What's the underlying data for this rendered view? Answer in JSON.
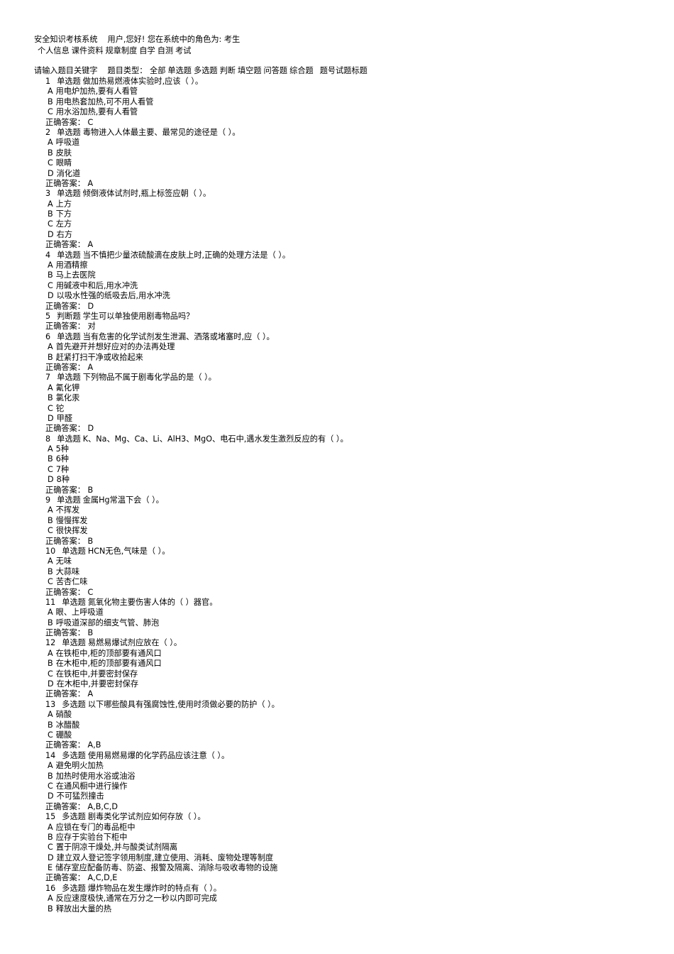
{
  "header": {
    "system_title": "安全知识考核系统",
    "greeting": "用户,您好! 您在系统中的角色为:",
    "role": "考生",
    "nav": [
      "个人信息",
      "课件资料",
      "规章制度",
      "自学",
      "自测",
      "考试"
    ]
  },
  "filter": {
    "keyword_prompt": "请输入题目关键字",
    "type_label": "题目类型：",
    "types": [
      "全部",
      "单选题",
      "多选题",
      "判断",
      "填空题",
      "问答题",
      "综合题"
    ],
    "number_label": "题号",
    "title_label": "试题标题"
  },
  "answer_label": "正确答案：",
  "questions": [
    {
      "num": "1",
      "type": "单选题",
      "text": "做加热易燃液体实验时,应该（ ）。",
      "options": [
        [
          "A",
          "用电炉加热,要有人看管"
        ],
        [
          "B",
          "用电热套加热,可不用人看管"
        ],
        [
          "C",
          "用水浴加热,要有人看管"
        ]
      ],
      "answer": "C"
    },
    {
      "num": "2",
      "type": "单选题",
      "text": "毒物进入人体最主要、最常见的途径是（ ）。",
      "options": [
        [
          "A",
          "呼吸道"
        ],
        [
          "B",
          "皮肤"
        ],
        [
          "C",
          "眼睛"
        ],
        [
          "D",
          "消化道"
        ]
      ],
      "answer": "A"
    },
    {
      "num": "3",
      "type": "单选题",
      "text": "倾倒液体试剂时,瓶上标签应朝（ ）。",
      "options": [
        [
          "A",
          "上方"
        ],
        [
          "B",
          "下方"
        ],
        [
          "C",
          "左方"
        ],
        [
          "D",
          "右方"
        ]
      ],
      "answer": "A"
    },
    {
      "num": "4",
      "type": "单选题",
      "text": "当不慎把少量浓硫酸滴在皮肤上时,正确的处理方法是（ ）。",
      "options": [
        [
          "A",
          "用酒精擦"
        ],
        [
          "B",
          "马上去医院"
        ],
        [
          "C",
          "用碱液中和后,用水冲洗"
        ],
        [
          "D",
          "以吸水性强的纸吸去后,用水冲洗"
        ]
      ],
      "answer": "D"
    },
    {
      "num": "5",
      "type": "判断题",
      "text": "学生可以单独使用剧毒物品吗？",
      "options": [],
      "answer": "对"
    },
    {
      "num": "6",
      "type": "单选题",
      "text": "当有危害的化学试剂发生泄漏、洒落或堵塞时,应（ ）。",
      "options": [
        [
          "A",
          "首先避开并想好应对的办法再处理"
        ],
        [
          "B",
          "赶紧打扫干净或收拾起来"
        ]
      ],
      "answer": "A"
    },
    {
      "num": "7",
      "type": "单选题",
      "text": "下列物品不属于剧毒化学品的是（ ）。",
      "options": [
        [
          "A",
          "氰化钾"
        ],
        [
          "B",
          "氯化汞"
        ],
        [
          "C",
          "铊"
        ],
        [
          "D",
          "甲醛"
        ]
      ],
      "answer": "D"
    },
    {
      "num": "8",
      "type": "单选题",
      "text": "K、Na、Mg、Ca、Li、AlH3、MgO、电石中,遇水发生激烈反应的有（ ）。",
      "options": [
        [
          "A",
          "5种"
        ],
        [
          "B",
          "6种"
        ],
        [
          "C",
          "7种"
        ],
        [
          "D",
          "8种"
        ]
      ],
      "answer": "B"
    },
    {
      "num": "9",
      "type": "单选题",
      "text": "金属Hg常温下会（ ）。",
      "options": [
        [
          "A",
          "不挥发"
        ],
        [
          "B",
          "慢慢挥发"
        ],
        [
          "C",
          "很快挥发"
        ]
      ],
      "answer": "B"
    },
    {
      "num": "10",
      "type": "单选题",
      "text": "HCN无色,气味是（ ）。",
      "options": [
        [
          "A",
          "无味"
        ],
        [
          "B",
          "大蒜味"
        ],
        [
          "C",
          "苦杏仁味"
        ]
      ],
      "answer": "C"
    },
    {
      "num": "11",
      "type": "单选题",
      "text": "氮氧化物主要伤害人体的（ ）器官。",
      "options": [
        [
          "A",
          "眼、上呼吸道"
        ],
        [
          "B",
          "呼吸道深部的细支气管、肺泡"
        ]
      ],
      "answer": "B"
    },
    {
      "num": "12",
      "type": "单选题",
      "text": "易燃易爆试剂应放在（ ）。",
      "options": [
        [
          "A",
          "在铁柜中,柜的顶部要有通风口"
        ],
        [
          "B",
          "在木柜中,柜的顶部要有通风口"
        ],
        [
          "C",
          "在铁柜中,并要密封保存"
        ],
        [
          "D",
          "在木柜中,并要密封保存"
        ]
      ],
      "answer": "A"
    },
    {
      "num": "13",
      "type": "多选题",
      "text": "以下哪些酸具有强腐蚀性,使用时须做必要的防护（ ）。",
      "options": [
        [
          "A",
          "硝酸"
        ],
        [
          "B",
          "冰醋酸"
        ],
        [
          "C",
          "硼酸"
        ]
      ],
      "answer": "A,B"
    },
    {
      "num": "14",
      "type": "多选题",
      "text": "使用易燃易爆的化学药品应该注意（ ）。",
      "options": [
        [
          "A",
          "避免明火加热"
        ],
        [
          "B",
          "加热时使用水浴或油浴"
        ],
        [
          "C",
          "在通风橱中进行操作"
        ],
        [
          "D",
          "不可猛烈撞击"
        ]
      ],
      "answer": "A,B,C,D"
    },
    {
      "num": "15",
      "type": "多选题",
      "text": "剧毒类化学试剂应如何存放（ ）。",
      "options": [
        [
          "A",
          "应锁在专门的毒品柜中"
        ],
        [
          "B",
          "应存于实验台下柜中"
        ],
        [
          "C",
          "置于阴凉干燥处,并与酸类试剂隔离"
        ],
        [
          "D",
          "建立双人登记签字领用制度,建立使用、消耗、废物处理等制度"
        ],
        [
          "E",
          "储存室应配备防毒、防盗、报警及隔离、消除与吸收毒物的设施"
        ]
      ],
      "answer": "A,C,D,E"
    },
    {
      "num": "16",
      "type": "多选题",
      "text": "爆炸物品在发生爆炸时的特点有（ ）。",
      "options": [
        [
          "A",
          "反应速度极快,通常在万分之一秒以内即可完成"
        ],
        [
          "B",
          "释放出大量的热"
        ]
      ],
      "answer": null
    }
  ]
}
